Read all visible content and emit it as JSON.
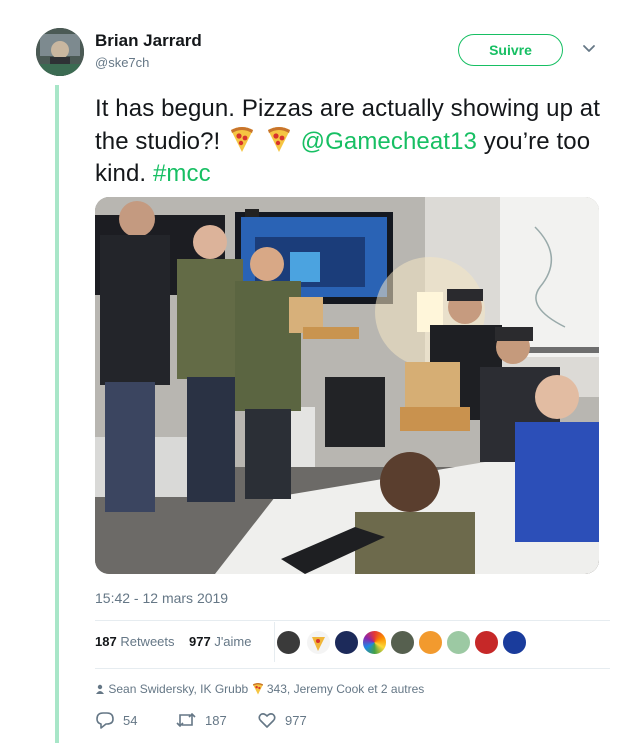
{
  "author": {
    "display_name": "Brian Jarrard",
    "handle": "@ske7ch"
  },
  "follow_button": {
    "label": "Suivre"
  },
  "tweet": {
    "text_main": "It has begun. Pizzas are actually showing up at the studio?!",
    "mention": "@Gamecheat13",
    "text_after": "you’re too kind.",
    "hashtag": "#mcc",
    "timestamp": "15:42 - 12 mars 2019"
  },
  "stats": {
    "retweets_count": "187",
    "retweets_label": "Retweets",
    "likes_count": "977",
    "likes_label": "J'aime"
  },
  "social_context": {
    "before_emoji": "Sean Swidersky, IK Grubb",
    "after_emoji": "343, Jeremy Cook et 2 autres"
  },
  "actions": {
    "reply_count": "54",
    "retweet_count": "187",
    "like_count": "977"
  },
  "colors": {
    "accent": "#17bf63",
    "thread_line": "#a8e6c8",
    "secondary_text": "#657786"
  }
}
